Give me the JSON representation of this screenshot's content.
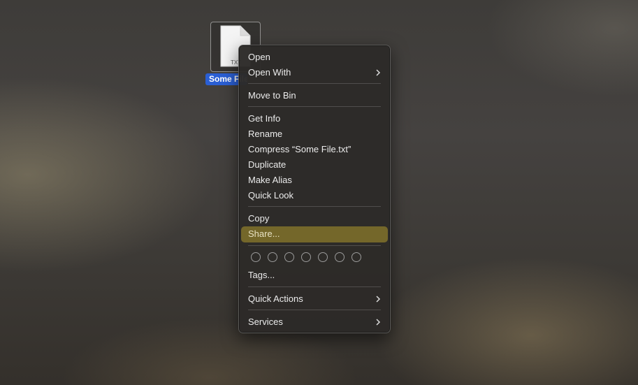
{
  "desktop": {
    "file": {
      "label": "Some File.txt",
      "icon": "text-document-icon",
      "badge": "TXT"
    }
  },
  "context_menu": {
    "items": [
      {
        "label": "Open"
      },
      {
        "label": "Open With",
        "submenu": true
      },
      {
        "label": "Move to Bin"
      },
      {
        "label": "Get Info"
      },
      {
        "label": "Rename"
      },
      {
        "label": "Compress “Some File.txt”"
      },
      {
        "label": "Duplicate"
      },
      {
        "label": "Make Alias"
      },
      {
        "label": "Quick Look"
      },
      {
        "label": "Copy"
      },
      {
        "label": "Share...",
        "highlighted": true
      },
      {
        "label": "Tags..."
      },
      {
        "label": "Quick Actions",
        "submenu": true
      },
      {
        "label": "Services",
        "submenu": true
      }
    ],
    "tag_colors_count": 7,
    "highlight_color": "#74672a"
  },
  "colors": {
    "selection": "#2a5fd4",
    "menu_background": "#2c2a28"
  }
}
